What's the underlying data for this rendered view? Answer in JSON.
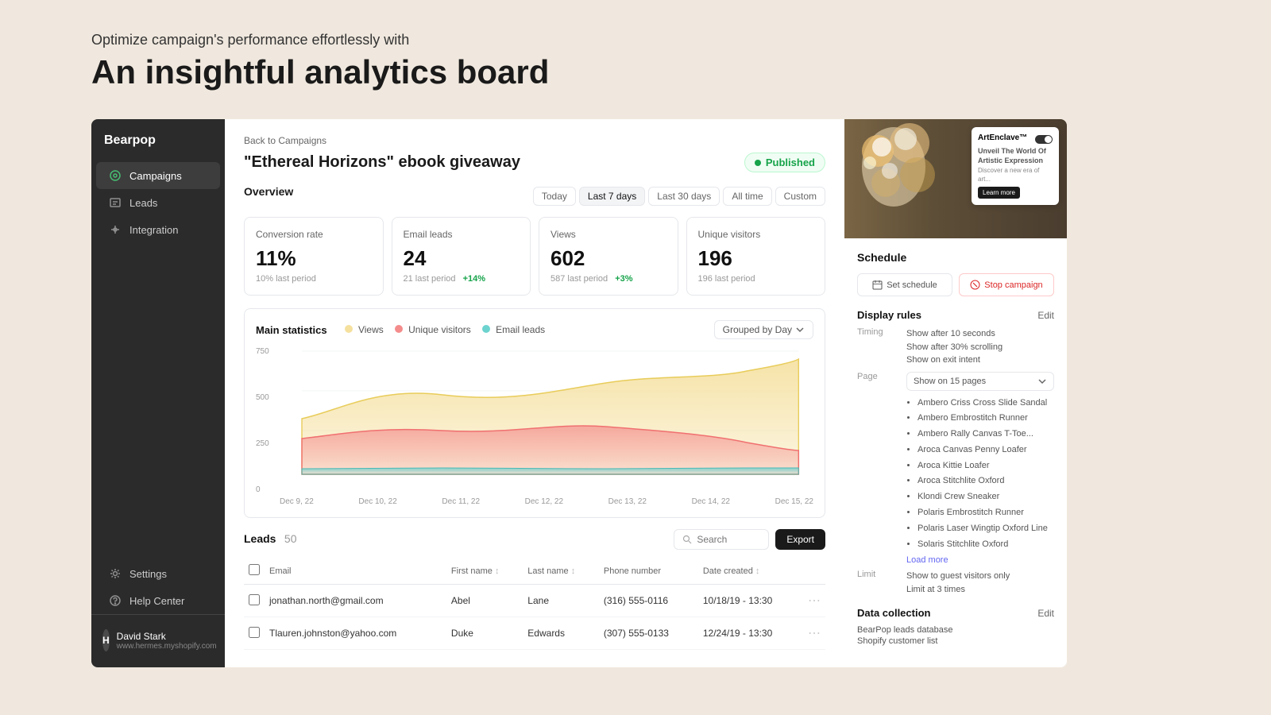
{
  "hero": {
    "subtitle": "Optimize campaign's performance effortlessly with",
    "title": "An insightful analytics board"
  },
  "sidebar": {
    "brand": "Bearpop",
    "items": [
      {
        "label": "Campaigns",
        "icon": "campaigns-icon",
        "active": true
      },
      {
        "label": "Leads",
        "icon": "leads-icon",
        "active": false
      },
      {
        "label": "Integration",
        "icon": "integration-icon",
        "active": false
      },
      {
        "label": "Settings",
        "icon": "settings-icon",
        "active": false
      },
      {
        "label": "Help Center",
        "icon": "help-icon",
        "active": false
      }
    ],
    "user": {
      "initials": "H",
      "name": "David Stark",
      "url": "www.hermes.myshopify.com"
    }
  },
  "breadcrumb": "Back to Campaigns",
  "campaign_title": "\"Ethereal Horizons\" ebook giveaway",
  "published_label": "Published",
  "overview": {
    "title": "Overview",
    "time_filters": [
      "Today",
      "Last 7 days",
      "Last 30 days",
      "All time",
      "Custom"
    ],
    "active_filter": "Last 7 days",
    "metrics": [
      {
        "label": "Conversion rate",
        "value": "11%",
        "sub": "10% last period",
        "change": null
      },
      {
        "label": "Email leads",
        "value": "24",
        "sub": "21 last period",
        "change": "+14%"
      },
      {
        "label": "Views",
        "value": "602",
        "sub": "587 last period",
        "change": "+3%"
      },
      {
        "label": "Unique visitors",
        "value": "196",
        "sub": "196 last period",
        "change": null
      }
    ]
  },
  "chart": {
    "title": "Main statistics",
    "grouped_by": "Grouped by Day",
    "legend": [
      {
        "label": "Views",
        "color": "#f5e09e"
      },
      {
        "label": "Unique visitors",
        "color": "#f48c8c"
      },
      {
        "label": "Email leads",
        "color": "#6dd3cf"
      }
    ],
    "y_labels": [
      "750",
      "500",
      "250",
      "0"
    ],
    "x_labels": [
      "Dec 9, 22",
      "Dec 10, 22",
      "Dec 11, 22",
      "Dec 12, 22",
      "Dec 13, 22",
      "Dec 14, 22",
      "Dec 15, 22"
    ]
  },
  "leads": {
    "title": "Leads",
    "count": "50",
    "search_placeholder": "Search",
    "export_label": "Export",
    "columns": [
      "Email",
      "First name",
      "Last name",
      "Phone number",
      "Date created"
    ],
    "rows": [
      {
        "email": "jonathan.north@gmail.com",
        "first": "Abel",
        "last": "Lane",
        "phone": "(316) 555-0116",
        "date": "10/18/19 - 13:30"
      },
      {
        "email": "Tlauren.johnston@yahoo.com",
        "first": "Duke",
        "last": "Edwards",
        "phone": "(307) 555-0133",
        "date": "12/24/19 - 13:30"
      }
    ]
  },
  "right_panel": {
    "preview": {
      "popup_brand": "ArtEnclave™",
      "popup_tagline": "Unveil The World Of Artistic Expression",
      "popup_body": "Discover a new era of art...",
      "popup_btn": "Learn more"
    },
    "schedule": {
      "title": "Schedule",
      "set_schedule_label": "Set schedule",
      "stop_campaign_label": "Stop campaign"
    },
    "display_rules": {
      "title": "Display rules",
      "edit_label": "Edit",
      "timing_label": "Timing",
      "timing_values": [
        "Show after 10 seconds",
        "Show after 30% scrolling",
        "Show on exit intent"
      ],
      "page_label": "Page",
      "page_select": "Show on 15 pages",
      "pages": [
        "Ambero Criss Cross Slide Sandal",
        "Ambero Embrostitch Runner",
        "Ambero Rally Canvas T-Toe...",
        "Aroca Canvas Penny Loafer",
        "Aroca Kittie Loafer",
        "Aroca Stitchlite Oxford",
        "Klondi Crew Sneaker",
        "Polaris Embrostitch Runner",
        "Polaris Laser Wingtip Oxford Line",
        "Solaris Stitchlite Oxford"
      ],
      "load_more": "Load more",
      "limit_label": "Limit",
      "limit_values": [
        "Show to guest visitors only",
        "Limit at 3 times"
      ]
    },
    "data_collection": {
      "title": "Data collection",
      "edit_label": "Edit",
      "items": [
        "BearPop leads database",
        "Shopify customer list"
      ]
    }
  }
}
